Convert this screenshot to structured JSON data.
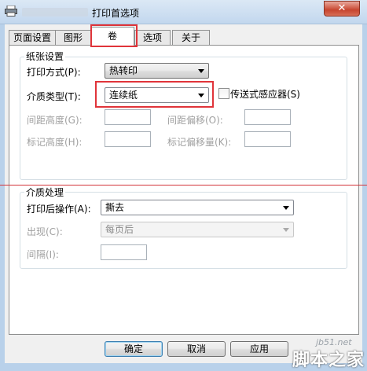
{
  "window": {
    "title": "打印首选项",
    "close_glyph": "✕"
  },
  "tabs": [
    {
      "label": "页面设置"
    },
    {
      "label": "图形"
    },
    {
      "label": "卷",
      "active": true
    },
    {
      "label": "选项"
    },
    {
      "label": "关于"
    }
  ],
  "paper_settings": {
    "group_label": "纸张设置",
    "print_method": {
      "label": "打印方式(P):",
      "value": "热转印"
    },
    "media_type": {
      "label": "介质类型(T):",
      "value": "连续纸"
    },
    "transmissive_sensor": {
      "label": "传送式感应器(S)",
      "checked": false
    },
    "gap_height": {
      "label": "间距高度(G):",
      "value": ""
    },
    "gap_offset": {
      "label": "间距偏移(O):",
      "value": ""
    },
    "mark_height": {
      "label": "标记高度(H):",
      "value": ""
    },
    "mark_offset": {
      "label": "标记偏移量(K):",
      "value": ""
    }
  },
  "media_handling": {
    "group_label": "介质处理",
    "post_print_action": {
      "label": "打印后操作(A):",
      "value": "撕去"
    },
    "occurrence": {
      "label": "出现(C):",
      "value": "每页后"
    },
    "interval": {
      "label": "间隔(I):",
      "value": ""
    }
  },
  "buttons": {
    "ok": "确定",
    "cancel": "取消",
    "apply": "应用"
  },
  "watermark": {
    "url": "jb51.net",
    "text": "脚本之家"
  },
  "colors": {
    "highlight": "#e0343a",
    "titlebar": "#c2d7ee",
    "close": "#c7452f"
  }
}
